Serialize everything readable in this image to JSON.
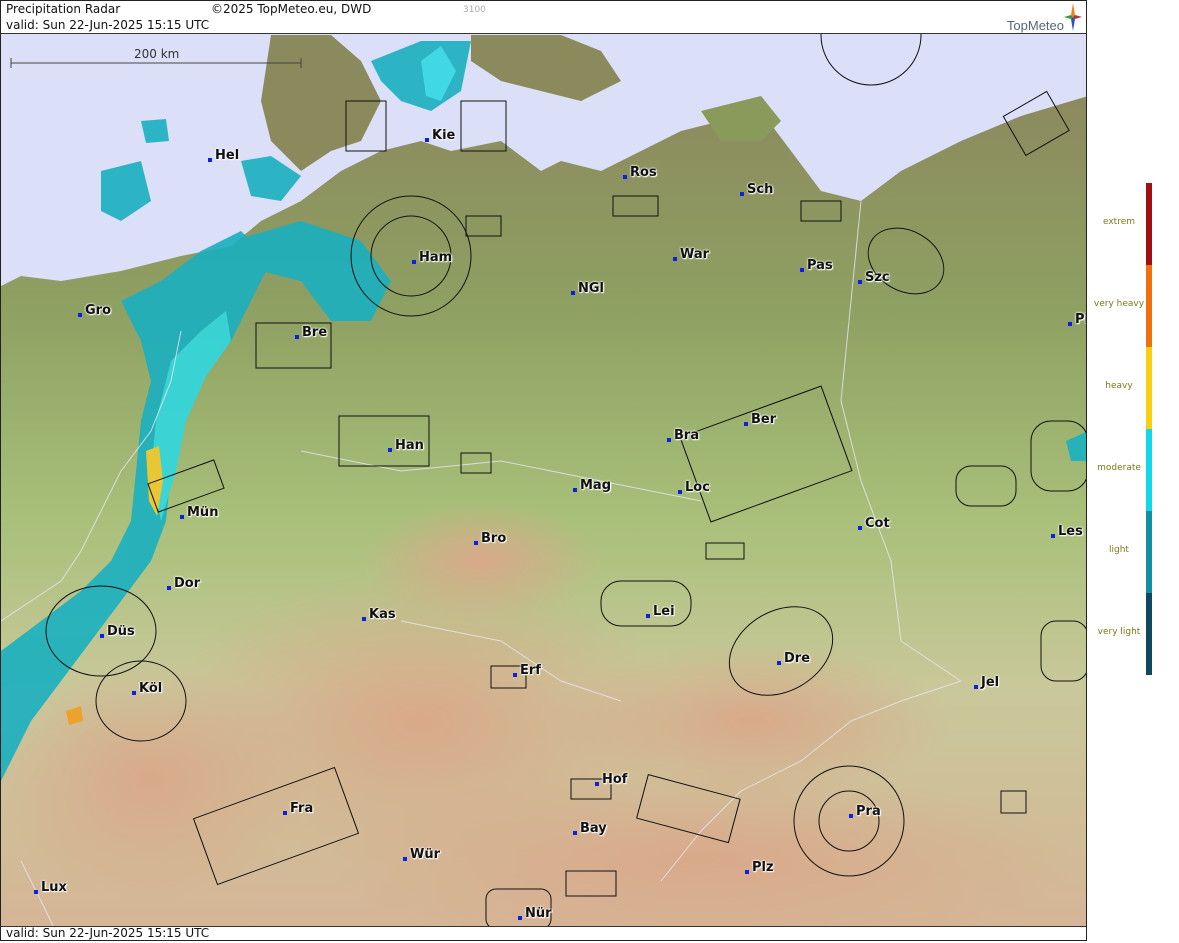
{
  "header": {
    "title": "Precipitation Radar",
    "copyright": "©2025 TopMeteo.eu, DWD",
    "code": "3100",
    "valid": "valid:  Sun  22-Jun-2025 15:15 UTC",
    "logo": "TopMeteo"
  },
  "footer": {
    "valid": "valid:  Sun  22-Jun-2025 15:15 UTC"
  },
  "scale": {
    "label": "200 km"
  },
  "cities": [
    "Kie",
    "Hel",
    "Ros",
    "Sch",
    "Ham",
    "War",
    "Pas",
    "Szc",
    "NGl",
    "Gro",
    "Bre",
    "Pil",
    "Ber",
    "Bra",
    "Han",
    "Mag",
    "Loc",
    "Mün",
    "Cot",
    "Les",
    "Bro",
    "Dor",
    "Kas",
    "Lei",
    "Düs",
    "Dre",
    "Erf",
    "Köl",
    "Jel",
    "Hof",
    "Fra",
    "Pra",
    "Bay",
    "Wür",
    "Plz",
    "Lux",
    "Nür"
  ],
  "legend": {
    "items": [
      {
        "label": "extrem",
        "color": "#a01010"
      },
      {
        "label": "very heavy",
        "color": "#f07010"
      },
      {
        "label": "heavy",
        "color": "#f8d010"
      },
      {
        "label": "moderate",
        "color": "#10d8e8"
      },
      {
        "label": "light",
        "color": "#1090a0"
      },
      {
        "label": "very light",
        "color": "#104860"
      }
    ]
  },
  "colors": {
    "sea": "#dcdff8",
    "lowland": "#8a9a5a",
    "upland": "#c8b89a",
    "radar_light": "#1ab0c0",
    "radar_moderate": "#30d8e0",
    "radar_heavy": "#f0c830",
    "city_dot": "#1020e0"
  }
}
